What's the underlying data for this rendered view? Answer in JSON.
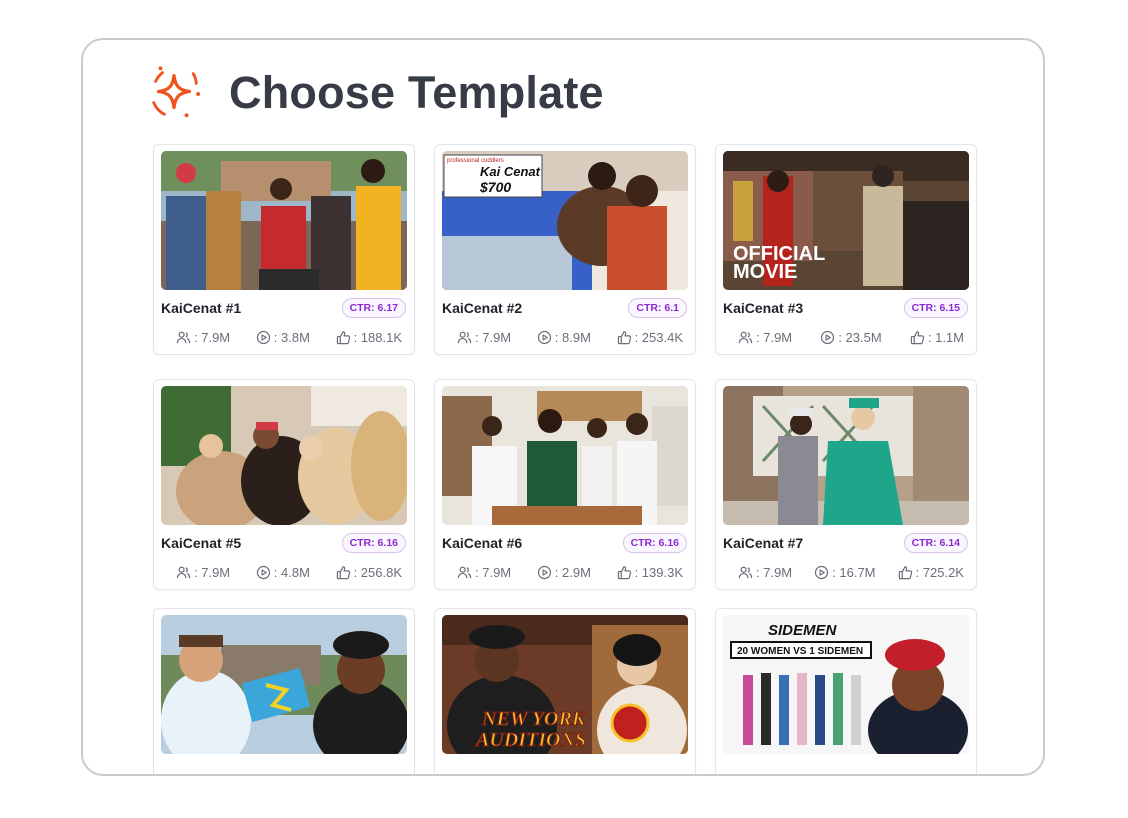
{
  "header": {
    "title": "Choose Template",
    "icon": "sparkle-icon",
    "accent": "#f0541e"
  },
  "stat_icons": {
    "subscribers": "users-icon",
    "views": "play-icon",
    "likes": "thumbs-up-icon"
  },
  "templates": [
    {
      "title": "KaiCenat #1",
      "ctr": "CTR: 6.17",
      "subscribers": ": 7.9M",
      "views": ": 3.8M",
      "likes": ": 188.1K"
    },
    {
      "title": "KaiCenat #2",
      "ctr": "CTR: 6.1",
      "subscribers": ": 7.9M",
      "views": ": 8.9M",
      "likes": ": 253.4K",
      "overlay_top": "Kai Cenat",
      "overlay_bottom": "$700",
      "overlay_small": "professional cuddlers"
    },
    {
      "title": "KaiCenat #3",
      "ctr": "CTR: 6.15",
      "subscribers": ": 7.9M",
      "views": ": 23.5M",
      "likes": ": 1.1M",
      "overlay_top": "OFFICIAL",
      "overlay_bottom": "MOVIE"
    },
    {
      "title": "KaiCenat #5",
      "ctr": "CTR: 6.16",
      "subscribers": ": 7.9M",
      "views": ": 4.8M",
      "likes": ": 256.8K"
    },
    {
      "title": "KaiCenat #6",
      "ctr": "CTR: 6.16",
      "subscribers": ": 7.9M",
      "views": ": 2.9M",
      "likes": ": 139.3K"
    },
    {
      "title": "KaiCenat #7",
      "ctr": "CTR: 6.14",
      "subscribers": ": 7.9M",
      "views": ": 16.7M",
      "likes": ": 725.2K"
    },
    {
      "title": "",
      "ctr": "",
      "subscribers": "",
      "views": "",
      "likes": ""
    },
    {
      "title": "",
      "ctr": "",
      "subscribers": "",
      "views": "",
      "likes": "",
      "overlay_top": "NEW YORK",
      "overlay_bottom": "AUDITIONS"
    },
    {
      "title": "",
      "ctr": "",
      "subscribers": "",
      "views": "",
      "likes": "",
      "overlay_top": "SIDEMEN",
      "overlay_bottom": "20 WOMEN VS 1 SIDEMEN"
    }
  ]
}
